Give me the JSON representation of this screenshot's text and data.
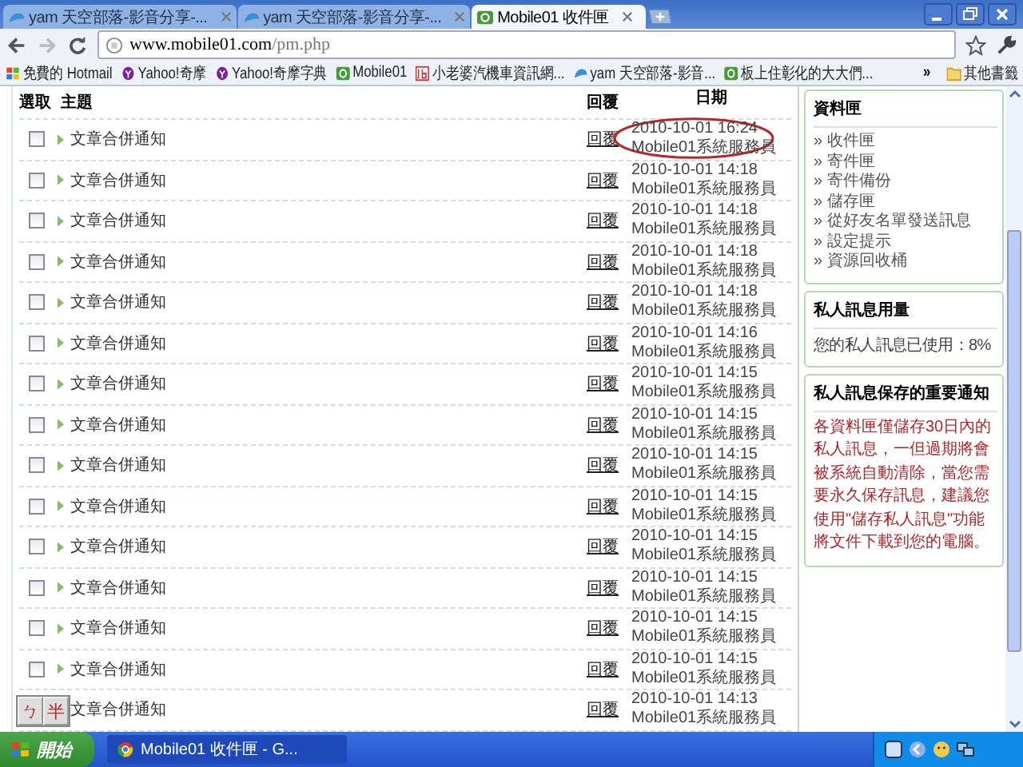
{
  "browser": {
    "tabs": [
      {
        "title": "yam 天空部落-影音分享-...",
        "kind": "yam",
        "selected": false
      },
      {
        "title": "yam 天空部落-影音分享-...",
        "kind": "yam",
        "selected": false
      },
      {
        "title": "Mobile01 收件匣",
        "kind": "m01",
        "selected": true
      }
    ],
    "address": {
      "host": "www.mobile01.com",
      "path": "/pm.php"
    },
    "bookmarks": [
      {
        "label": "免費的 Hotmail",
        "kind": "win"
      },
      {
        "label": "Yahoo!奇摩",
        "kind": "yahoo"
      },
      {
        "label": "Yahoo!奇摩字典",
        "kind": "yahoo"
      },
      {
        "label": "Mobile01",
        "kind": "m01"
      },
      {
        "label": "小老婆汽機車資訊網...",
        "kind": "jb"
      },
      {
        "label": "yam 天空部落-影音...",
        "kind": "yam"
      },
      {
        "label": "板上住彰化的大大們...",
        "kind": "m01"
      }
    ],
    "overflow": "»",
    "other_bookmarks": "其他書籤"
  },
  "inbox": {
    "columns": [
      "選取",
      "主題",
      "回覆",
      "日期"
    ],
    "rows": [
      {
        "checked": false,
        "subject": "文章合併通知",
        "reply": "回覆",
        "date": "2010-10-01 16:24",
        "sender": "Mobile01系統服務員",
        "circled": true
      },
      {
        "checked": false,
        "subject": "文章合併通知",
        "reply": "回覆",
        "date": "2010-10-01 14:18",
        "sender": "Mobile01系統服務員",
        "circled": false
      },
      {
        "checked": false,
        "subject": "文章合併通知",
        "reply": "回覆",
        "date": "2010-10-01 14:18",
        "sender": "Mobile01系統服務員",
        "circled": false
      },
      {
        "checked": false,
        "subject": "文章合併通知",
        "reply": "回覆",
        "date": "2010-10-01 14:18",
        "sender": "Mobile01系統服務員",
        "circled": false
      },
      {
        "checked": false,
        "subject": "文章合併通知",
        "reply": "回覆",
        "date": "2010-10-01 14:18",
        "sender": "Mobile01系統服務員",
        "circled": false
      },
      {
        "checked": false,
        "subject": "文章合併通知",
        "reply": "回覆",
        "date": "2010-10-01 14:16",
        "sender": "Mobile01系統服務員",
        "circled": false
      },
      {
        "checked": false,
        "subject": "文章合併通知",
        "reply": "回覆",
        "date": "2010-10-01 14:15",
        "sender": "Mobile01系統服務員",
        "circled": false
      },
      {
        "checked": false,
        "subject": "文章合併通知",
        "reply": "回覆",
        "date": "2010-10-01 14:15",
        "sender": "Mobile01系統服務員",
        "circled": false
      },
      {
        "checked": false,
        "subject": "文章合併通知",
        "reply": "回覆",
        "date": "2010-10-01 14:15",
        "sender": "Mobile01系統服務員",
        "circled": false
      },
      {
        "checked": false,
        "subject": "文章合併通知",
        "reply": "回覆",
        "date": "2010-10-01 14:15",
        "sender": "Mobile01系統服務員",
        "circled": false
      },
      {
        "checked": false,
        "subject": "文章合併通知",
        "reply": "回覆",
        "date": "2010-10-01 14:15",
        "sender": "Mobile01系統服務員",
        "circled": false
      },
      {
        "checked": false,
        "subject": "文章合併通知",
        "reply": "回覆",
        "date": "2010-10-01 14:15",
        "sender": "Mobile01系統服務員",
        "circled": false
      },
      {
        "checked": false,
        "subject": "文章合併通知",
        "reply": "回覆",
        "date": "2010-10-01 14:15",
        "sender": "Mobile01系統服務員",
        "circled": false
      },
      {
        "checked": false,
        "subject": "文章合併通知",
        "reply": "回覆",
        "date": "2010-10-01 14:15",
        "sender": "Mobile01系統服務員",
        "circled": false
      },
      {
        "subject": "文章合併通知",
        "reply": "回覆",
        "date": "2010-10-01 14:13",
        "sender": "Mobile01系統服務員",
        "circled": false
      }
    ]
  },
  "sidebar": {
    "folders": {
      "title": "資料匣",
      "items": [
        "» 收件匣",
        "» 寄件匣",
        "» 寄件備份",
        "» 儲存匣",
        "» 從好友名單發送訊息",
        "» 設定提示",
        "» 資源回收桶"
      ]
    },
    "usage": {
      "title": "私人訊息用量",
      "text": "您的私人訊息已使用：8%"
    },
    "notice": {
      "title": "私人訊息保存的重要通知",
      "text": "各資料匣僅儲存30日內的私人訊息，一但過期將會被系統自動清除，當您需要永久保存訊息，建議您使用\"儲存私人訊息\"功能將文件下載到您的電腦。"
    }
  },
  "ime": {
    "keys": [
      "ㄅ",
      "半"
    ]
  },
  "taskbar": {
    "start": "開始",
    "tasks": [
      {
        "title": "Mobile01 收件匣 - G...",
        "selected": true
      }
    ]
  }
}
